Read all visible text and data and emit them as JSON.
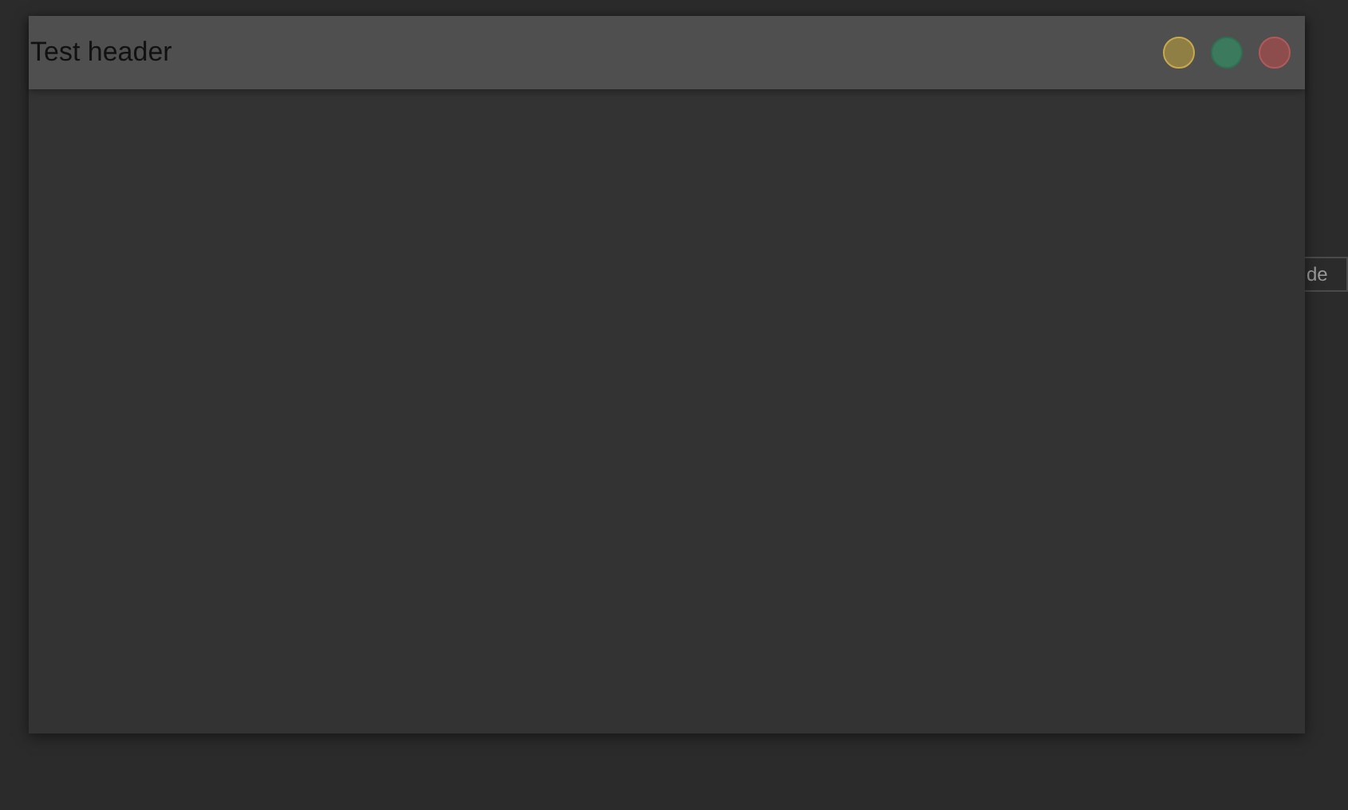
{
  "background": {
    "field_text": "de"
  },
  "window": {
    "title": "Test header",
    "buttons": [
      {
        "kind": "minimize",
        "color": "#8f7f45"
      },
      {
        "kind": "maximize",
        "color": "#3c7a5e"
      },
      {
        "kind": "close",
        "color": "#8e4d4d"
      }
    ]
  }
}
